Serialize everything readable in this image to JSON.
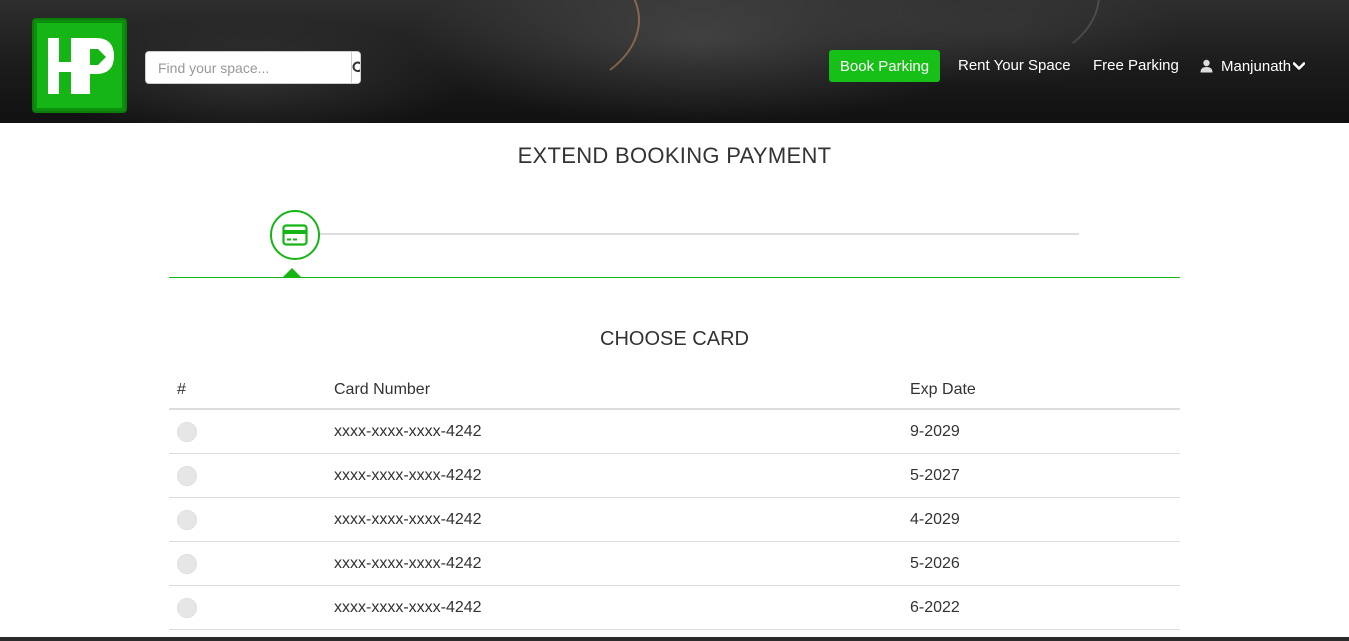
{
  "header": {
    "logo_text": "HP",
    "search": {
      "placeholder": "Find your space...",
      "value": ""
    },
    "nav": {
      "book_parking": "Book Parking",
      "rent_your_space": "Rent Your Space",
      "free_parking": "Free Parking",
      "user_name": "Manjunath"
    },
    "colors": {
      "brand_green": "#16c016"
    }
  },
  "main": {
    "title": "EXTEND BOOKING PAYMENT",
    "steps": [
      {
        "icon": "credit-card-icon",
        "active": true
      }
    ],
    "section_title": "CHOOSE CARD",
    "table": {
      "columns": [
        "#",
        "Card Number",
        "Exp Date"
      ],
      "rows": [
        {
          "card_number": "xxxx-xxxx-xxxx-4242",
          "exp_date": "9-2029"
        },
        {
          "card_number": "xxxx-xxxx-xxxx-4242",
          "exp_date": "5-2027"
        },
        {
          "card_number": "xxxx-xxxx-xxxx-4242",
          "exp_date": "4-2029"
        },
        {
          "card_number": "xxxx-xxxx-xxxx-4242",
          "exp_date": "5-2026"
        },
        {
          "card_number": "xxxx-xxxx-xxxx-4242",
          "exp_date": "6-2022"
        }
      ]
    }
  }
}
